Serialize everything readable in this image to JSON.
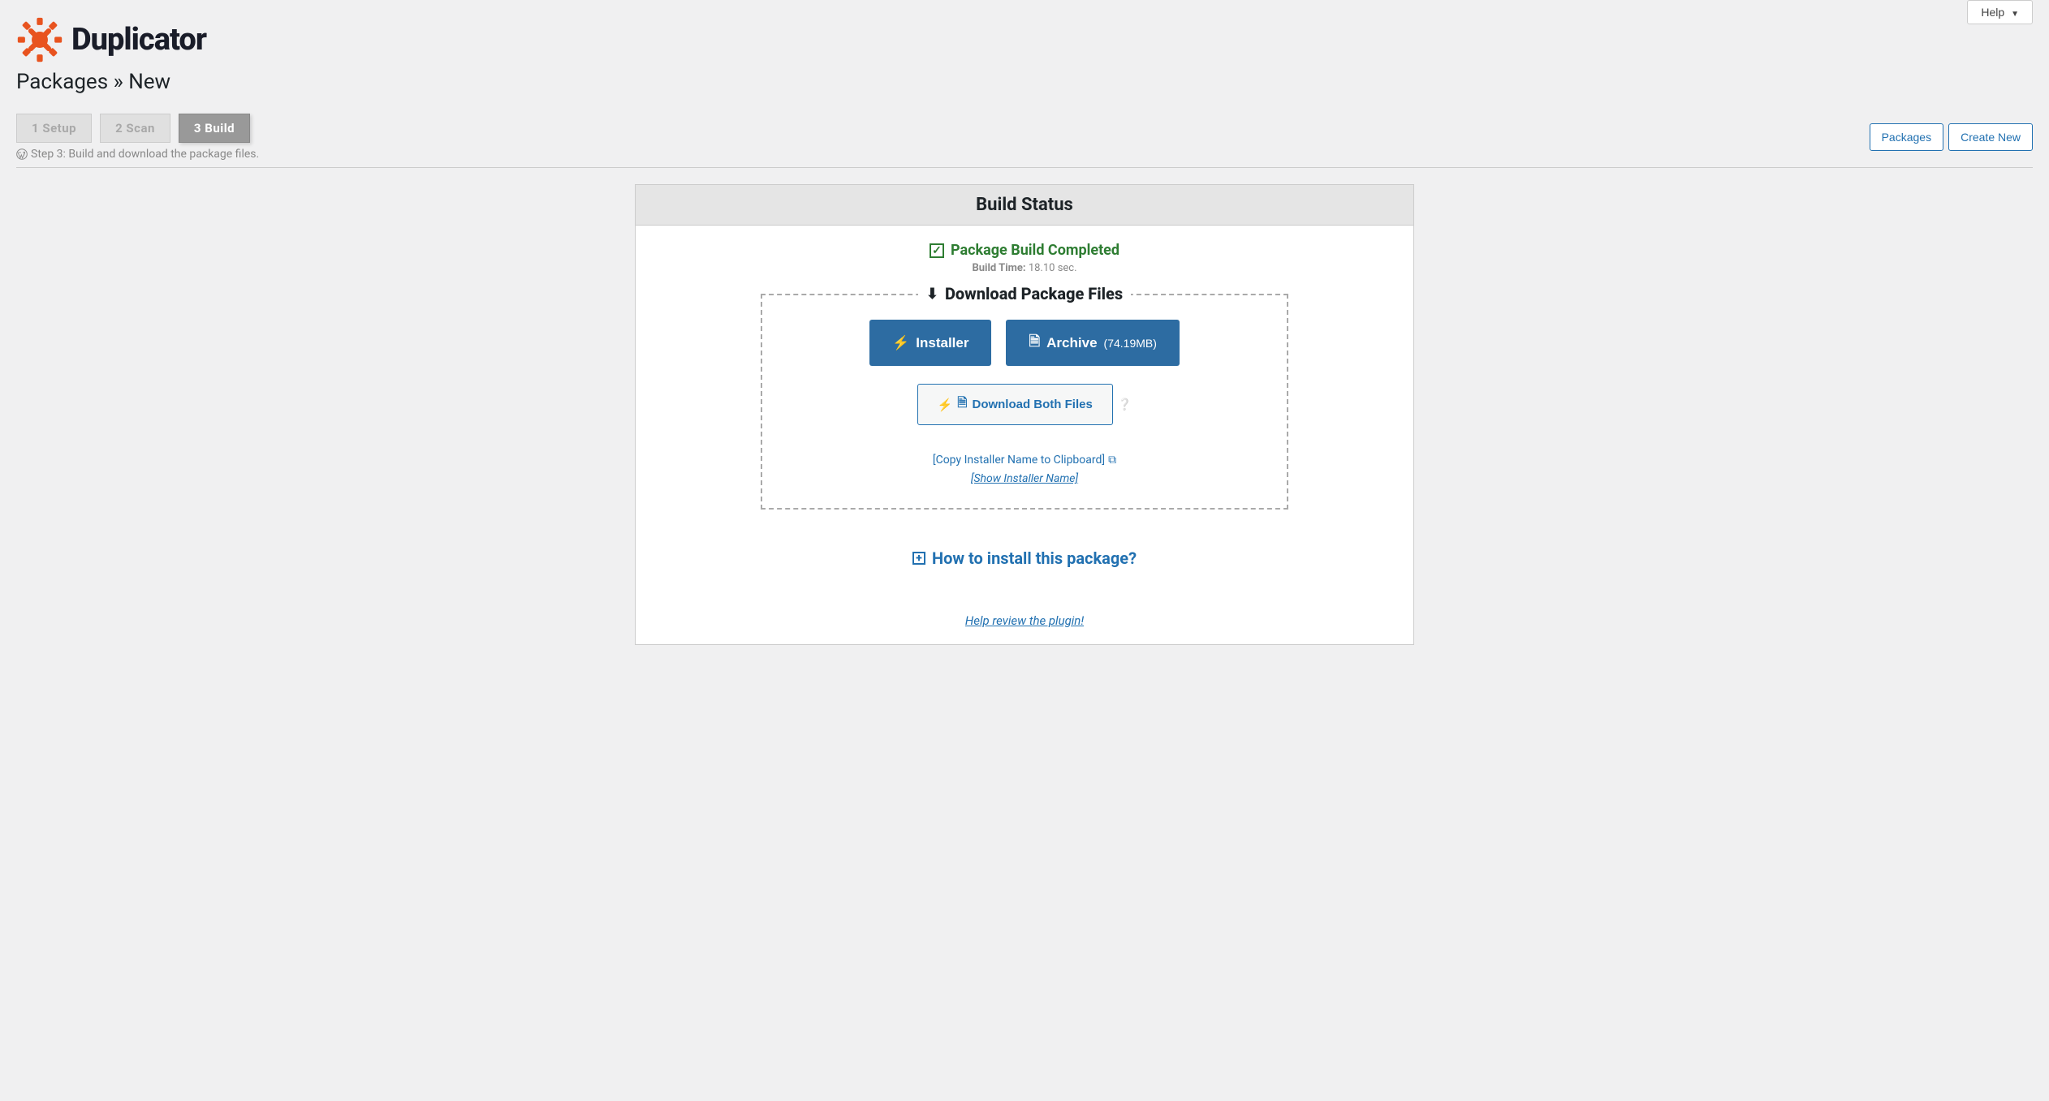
{
  "header": {
    "help_label": "Help",
    "brand": "Duplicator",
    "page_title": "Packages » New"
  },
  "tabs": {
    "setup": "1 Setup",
    "scan": "2 Scan",
    "build": "3 Build"
  },
  "step_desc": "Step 3: Build and download the package files.",
  "actions": {
    "packages": "Packages",
    "create_new": "Create New"
  },
  "panel": {
    "title": "Build Status",
    "success": "Package Build Completed",
    "build_time_label": "Build Time:",
    "build_time_value": "18.10 sec.",
    "download_title": "Download Package Files",
    "installer_label": "Installer",
    "archive_label": "Archive",
    "archive_size": "(74.19MB)",
    "download_both": "Download Both Files",
    "copy_installer": "[Copy Installer Name to Clipboard]",
    "show_installer": "[Show Installer Name]",
    "how_install": "How to install this package?",
    "review": "Help review the plugin!"
  }
}
